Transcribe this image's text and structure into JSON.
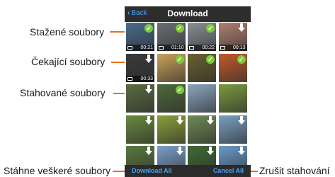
{
  "callouts": {
    "downloaded": "Stažené soubory",
    "waiting": "Čekající soubory",
    "downloading": "Stahované soubory",
    "download_all": "Stáhne veškeré soubory",
    "cancel_all": "Zrušit stahování"
  },
  "navbar": {
    "back_label": "Back",
    "title": "Download"
  },
  "toolbar": {
    "download_all_label": "Download All",
    "cancel_all_label": "Cancel All"
  },
  "thumbs": [
    {
      "row": 0,
      "col": 0,
      "status": "downloaded",
      "video": true,
      "time": "00:21",
      "color": "#4a6a8a"
    },
    {
      "row": 0,
      "col": 1,
      "status": "downloaded",
      "video": true,
      "time": "01:10",
      "color": "#6b6f75"
    },
    {
      "row": 0,
      "col": 2,
      "status": "downloaded",
      "video": true,
      "time": "00:22",
      "color": "#8a8f96"
    },
    {
      "row": 0,
      "col": 3,
      "status": "waiting",
      "video": true,
      "time": "00:13",
      "color": "#b08070"
    },
    {
      "row": 1,
      "col": 0,
      "status": "waiting",
      "video": true,
      "time": "00:33",
      "color": "#3a3a3a"
    },
    {
      "row": 1,
      "col": 1,
      "status": "downloaded",
      "video": false,
      "time": "",
      "color": "#c9a25a"
    },
    {
      "row": 1,
      "col": 2,
      "status": "downloaded",
      "video": false,
      "time": "",
      "color": "#6a6030"
    },
    {
      "row": 1,
      "col": 3,
      "status": "downloaded",
      "video": false,
      "time": "",
      "color": "#c25a2a"
    },
    {
      "row": 2,
      "col": 0,
      "status": "waiting",
      "video": false,
      "time": "",
      "color": "#5b6b40"
    },
    {
      "row": 2,
      "col": 1,
      "status": "downloaded",
      "video": false,
      "time": "",
      "color": "#4d6a3a"
    },
    {
      "row": 2,
      "col": 2,
      "status": "none",
      "video": false,
      "time": "",
      "color": "#8aa6c0"
    },
    {
      "row": 2,
      "col": 3,
      "status": "none",
      "video": false,
      "time": "",
      "color": "#7a9a40"
    },
    {
      "row": 3,
      "col": 0,
      "status": "waiting",
      "video": false,
      "time": "",
      "color": "#6a8a40"
    },
    {
      "row": 3,
      "col": 1,
      "status": "waiting",
      "video": false,
      "time": "",
      "color": "#8aa03a"
    },
    {
      "row": 3,
      "col": 2,
      "status": "waiting",
      "video": false,
      "time": "",
      "color": "#6f8a55"
    },
    {
      "row": 3,
      "col": 3,
      "status": "waiting",
      "video": false,
      "time": "",
      "color": "#7aa0c0"
    },
    {
      "row": 4,
      "col": 0,
      "status": "waiting",
      "video": false,
      "time": "",
      "color": "#5a7a40"
    },
    {
      "row": 4,
      "col": 1,
      "status": "waiting",
      "video": false,
      "time": "",
      "color": "#7aa0c8"
    },
    {
      "row": 4,
      "col": 2,
      "status": "waiting",
      "video": false,
      "time": "",
      "color": "#3f6a35"
    },
    {
      "row": 4,
      "col": 3,
      "status": "waiting",
      "video": false,
      "time": "",
      "color": "#6a9acb"
    }
  ],
  "colors": {
    "accent": "#e8701e",
    "done": "#7ccc3a",
    "ios_blue": "#4aa3ff",
    "bar": "#2d2d2d"
  }
}
